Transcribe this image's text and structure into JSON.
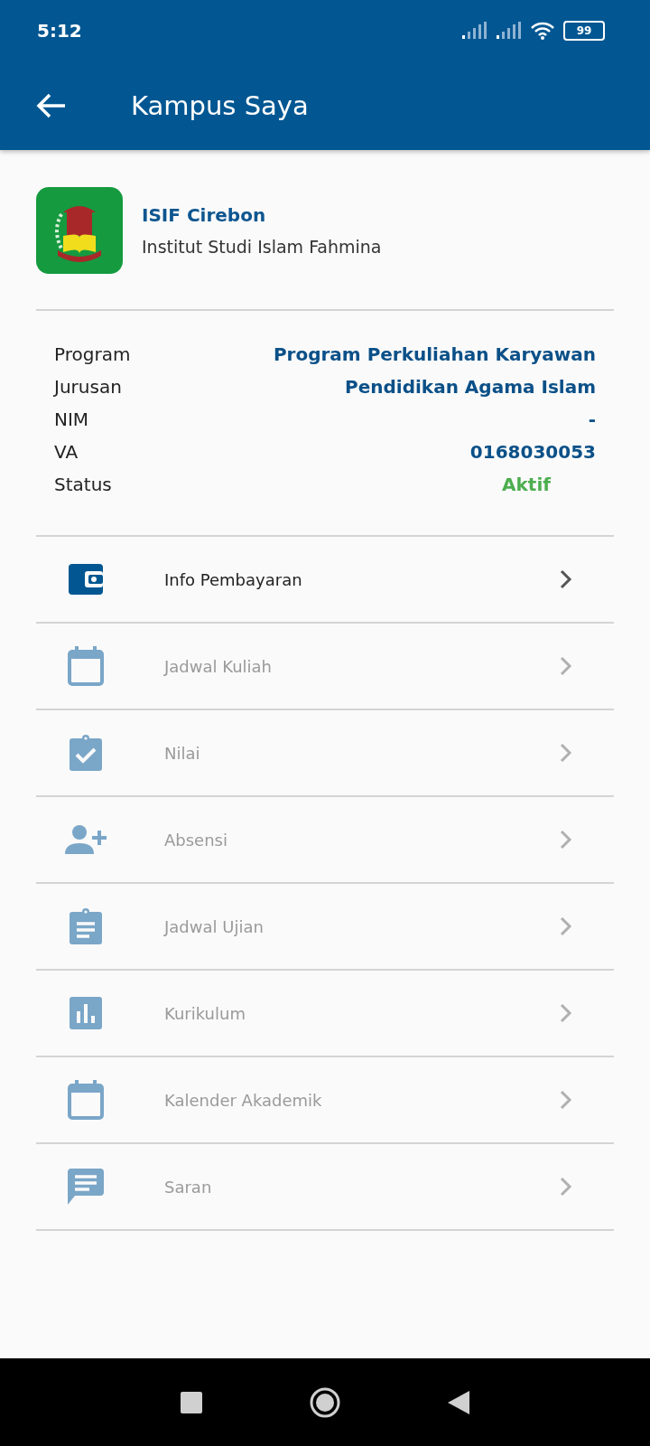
{
  "status_bar": {
    "time": "5:12",
    "battery": "99"
  },
  "app_bar": {
    "title": "Kampus Saya"
  },
  "campus": {
    "short_name": "ISIF Cirebon",
    "full_name": "Institut Studi Islam Fahmina"
  },
  "details": [
    {
      "label": "Program",
      "value": "Program Perkuliahan Karyawan",
      "kind": "text"
    },
    {
      "label": "Jurusan",
      "value": "Pendidikan Agama Islam",
      "kind": "text"
    },
    {
      "label": "NIM",
      "value": "-",
      "kind": "text"
    },
    {
      "label": "VA",
      "value": "0168030053",
      "kind": "text"
    },
    {
      "label": "Status",
      "value": "Aktif",
      "kind": "status"
    }
  ],
  "menu": [
    {
      "label": "Info Pembayaran",
      "kind": "wallet",
      "disabled": false
    },
    {
      "label": "Jadwal Kuliah",
      "kind": "calendar",
      "disabled": true
    },
    {
      "label": "Nilai",
      "kind": "clipboard-check",
      "disabled": true
    },
    {
      "label": "Absensi",
      "kind": "person-add",
      "disabled": true
    },
    {
      "label": "Jadwal Ujian",
      "kind": "clipboard-list",
      "disabled": true
    },
    {
      "label": "Kurikulum",
      "kind": "chart",
      "disabled": true
    },
    {
      "label": "Kalender Akademik",
      "kind": "calendar",
      "disabled": true
    },
    {
      "label": "Saran",
      "kind": "chat",
      "disabled": true
    }
  ]
}
